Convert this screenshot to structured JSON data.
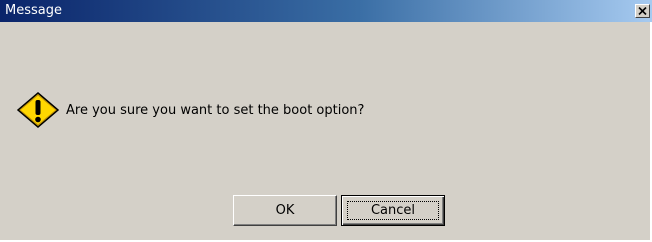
{
  "window": {
    "title": "Message",
    "close_symbol": "✕"
  },
  "dialog": {
    "icon": "warning-icon",
    "message": "Are you sure you want to set the boot option?"
  },
  "buttons": {
    "ok_label": "OK",
    "cancel_label": "Cancel"
  },
  "colors": {
    "dialog_bg": "#d4d0c8",
    "titlebar_start": "#0a246a",
    "titlebar_end": "#a6caf0",
    "warning_fill": "#ffd700"
  }
}
